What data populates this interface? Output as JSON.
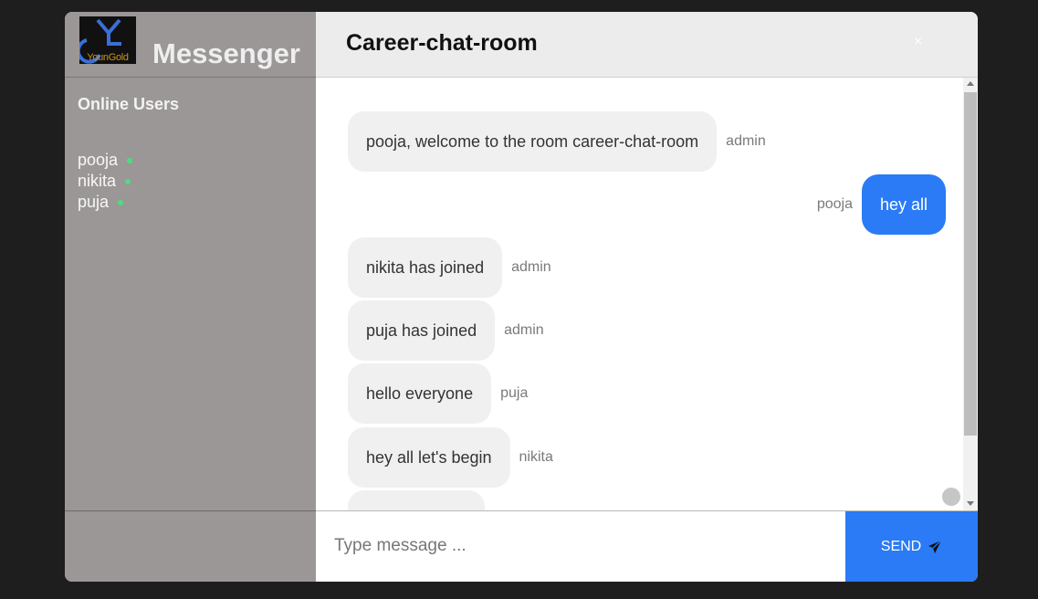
{
  "brand": {
    "logo_text": "YounGold",
    "app_title": "Messenger"
  },
  "sidebar": {
    "online_heading": "Online Users",
    "users": [
      "pooja",
      "nikita",
      "puja"
    ],
    "online_color": "#4ade80"
  },
  "room": {
    "title": "Career-chat-room",
    "close_label": "×"
  },
  "messages": [
    {
      "text": "pooja, welcome to the room career-chat-room",
      "sender": "admin",
      "mine": false
    },
    {
      "text": "hey all",
      "sender": "pooja",
      "mine": true
    },
    {
      "text": "nikita has joined",
      "sender": "admin",
      "mine": false
    },
    {
      "text": "puja has joined",
      "sender": "admin",
      "mine": false
    },
    {
      "text": "hello everyone",
      "sender": "puja",
      "mine": false
    },
    {
      "text": "hey all let's begin",
      "sender": "nikita",
      "mine": false
    },
    {
      "text": "",
      "sender": "",
      "mine": false
    }
  ],
  "composer": {
    "placeholder": "Type message ...",
    "value": "",
    "send_label": "SEND",
    "send_icon": "paper-plane-icon"
  },
  "colors": {
    "accent": "#2a7bf5",
    "sidebar_bg": "#9c9797",
    "bubble_bg": "#f0f0f0"
  }
}
